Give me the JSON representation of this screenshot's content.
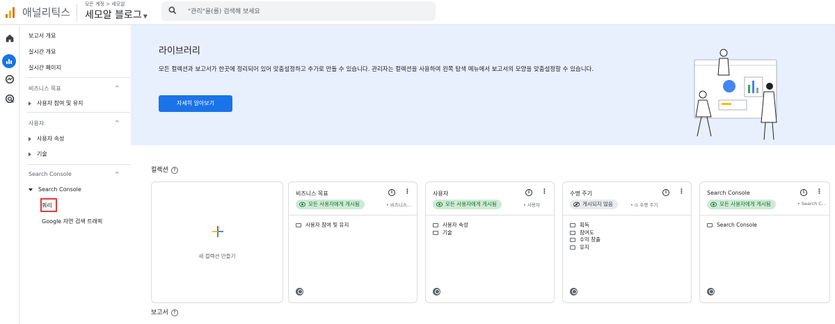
{
  "header": {
    "app_name": "애널리틱스",
    "breadcrumb": "모든 계정 > 세모알",
    "property_name": "세모알 블로그",
    "search_placeholder": "\"관리\"을(를) 검색해 보세요"
  },
  "sidebar": {
    "top_items": [
      {
        "label": "보고서 개요"
      },
      {
        "label": "실시간 개요"
      },
      {
        "label": "실시간 페이지"
      }
    ],
    "sections": [
      {
        "title": "비즈니스 목표",
        "items": [
          {
            "label": "사용자 참여 및 유지"
          }
        ]
      },
      {
        "title": "사용자",
        "items": [
          {
            "label": "사용자 속성"
          },
          {
            "label": "기술"
          }
        ]
      },
      {
        "title": "Search Console",
        "items": [
          {
            "label": "Search Console"
          }
        ],
        "subitems": [
          {
            "label": "쿼리"
          },
          {
            "label": "Google 자연 검색 트래픽"
          }
        ]
      }
    ]
  },
  "banner": {
    "title": "라이브러리",
    "description": "모든 컬렉션과 보고서가 한곳에 정리되어 있어 맞춤설정하고 추가로 만들 수 있습니다. 관리자는 컬렉션을 사용하여 왼쪽 탐색 메뉴에서 보고서의 모양을 맞춤설정할 수 있습니다.",
    "button_label": "자세히 알아보기"
  },
  "collections": {
    "title": "컬렉션",
    "new_label": "새 컬렉션 만들기",
    "cards": [
      {
        "title": "비즈니스 목표",
        "status": "모든 사용자에게 게시됨",
        "meta": "비즈니스...",
        "folders": [
          "사용자 참여 및 유지"
        ]
      },
      {
        "title": "사용자",
        "status": "모든 사용자에게 게시됨",
        "meta": "사용자",
        "folders": [
          "사용자 속성",
          "기술"
        ]
      },
      {
        "title": "수명 주기",
        "status": "게시되지 않음",
        "meta": "수명 주기",
        "folders": [
          "획득",
          "참여도",
          "수익 창출",
          "유지"
        ]
      },
      {
        "title": "Search Console",
        "status": "모든 사용자에게 게시됨",
        "meta": "Search C...",
        "folders": [
          "Search Console"
        ]
      }
    ]
  },
  "reports": {
    "title": "보고서"
  },
  "icons": {
    "rail": [
      "home-icon",
      "reports-icon",
      "explore-icon",
      "advertising-icon"
    ]
  },
  "colors": {
    "accent": "#1a73e8",
    "banner_bg": "#e8f0fe",
    "published_chip": "#ceead6",
    "highlight": "#e53935"
  }
}
